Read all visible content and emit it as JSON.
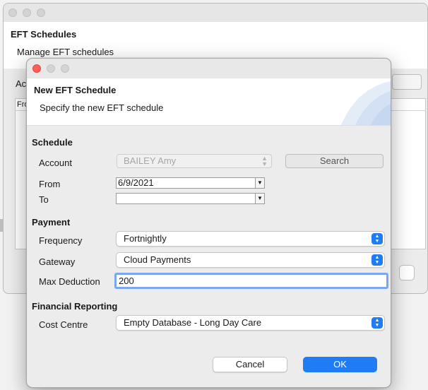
{
  "back_window": {
    "title": "EFT Schedules",
    "subtitle": "Manage EFT schedules",
    "field_label_partial": "Acc",
    "table_header_partial": "Fro"
  },
  "dialog": {
    "title": "New EFT Schedule",
    "subtitle": "Specify the new EFT schedule",
    "schedule": {
      "section_label": "Schedule",
      "account_label": "Account",
      "account_value": "BAILEY Amy",
      "search_label": "Search",
      "from_label": "From",
      "from_value": "6/9/2021",
      "to_label": "To",
      "to_value": ""
    },
    "payment": {
      "section_label": "Payment",
      "frequency_label": "Frequency",
      "frequency_value": "Fortnightly",
      "gateway_label": "Gateway",
      "gateway_value": "Cloud Payments",
      "max_deduction_label": "Max Deduction",
      "max_deduction_value": "200"
    },
    "financial": {
      "section_label": "Financial Reporting",
      "cost_centre_label": "Cost Centre",
      "cost_centre_value": "Empty Database - Long Day Care"
    },
    "buttons": {
      "cancel_label": "Cancel",
      "ok_label": "OK"
    }
  },
  "colors": {
    "accent": "#1f7cf5",
    "focus_ring": "#7aa8ee",
    "close_button": "#fe5f57"
  }
}
